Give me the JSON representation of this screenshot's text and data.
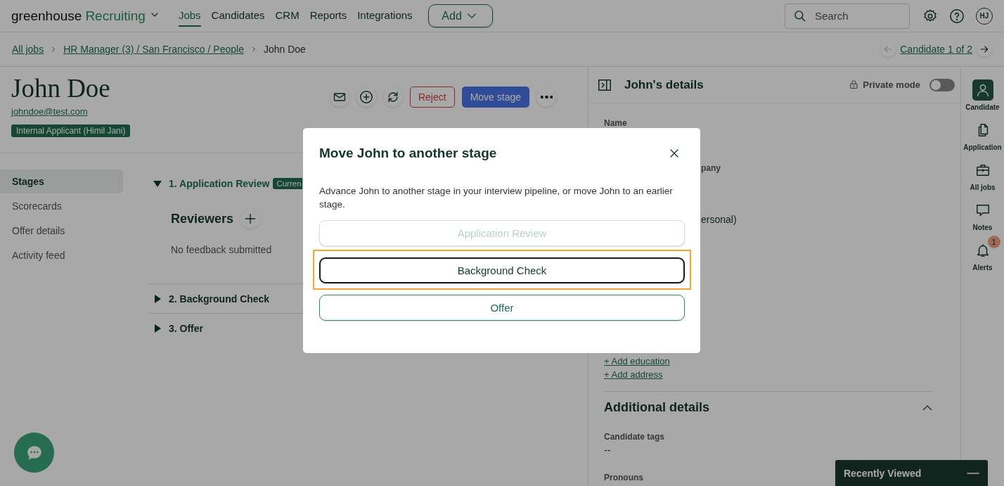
{
  "nav": {
    "logo": "greenhouse",
    "product": "Recruiting",
    "links": [
      {
        "label": "Jobs",
        "selected": true
      },
      {
        "label": "Candidates",
        "selected": false
      },
      {
        "label": "CRM",
        "selected": false
      },
      {
        "label": "Reports",
        "selected": false
      },
      {
        "label": "Integrations",
        "selected": false
      }
    ],
    "add_button": "Add",
    "search": {
      "placeholder": "Search"
    },
    "avatar": "HJ"
  },
  "breadcrumb": {
    "items": [
      "All jobs",
      "HR Manager (3) / San Francisco / People"
    ],
    "current": "John Doe",
    "pager": "Candidate 1 of 2",
    "prev_disabled": true
  },
  "candidate": {
    "name": "John Doe",
    "email": "johndoe@test.com",
    "tag": "Internal Applicant (Himil Jani)"
  },
  "actions": {
    "reject": "Reject",
    "move": "Move stage"
  },
  "sections": [
    {
      "label": "Stages",
      "selected": true
    },
    {
      "label": "Scorecards",
      "selected": false
    },
    {
      "label": "Offer details",
      "selected": false
    },
    {
      "label": "Activity feed",
      "selected": false
    }
  ],
  "stages": [
    {
      "label": "1. Application Review",
      "expanded": true,
      "badge": "Curren",
      "reviewers": "Reviewers",
      "feedback": "No feedback submitted"
    },
    {
      "label": "2. Background Check",
      "expanded": false
    },
    {
      "label": "3. Offer",
      "expanded": false
    }
  ],
  "details": {
    "title": "John's details",
    "private_mode": {
      "label": "Private mode",
      "on": false
    },
    "name_label": "Name",
    "fragment_label": "pany",
    "fragment_value": "ersonal)",
    "links": [
      "+ Add education",
      "+ Add address"
    ],
    "additional": {
      "title": "Additional details",
      "expanded": true,
      "fields": [
        {
          "label": "Candidate tags",
          "value": "--"
        },
        {
          "label": "Pronouns"
        }
      ]
    }
  },
  "rail": [
    {
      "label": "Candidate",
      "kind": "person",
      "selected": true
    },
    {
      "label": "Application",
      "kind": "documents",
      "selected": false
    },
    {
      "label": "All jobs",
      "kind": "briefcase",
      "selected": false
    },
    {
      "label": "Notes",
      "kind": "speech",
      "selected": false
    },
    {
      "label": "Alerts",
      "kind": "bell",
      "selected": false,
      "badge": "1"
    }
  ],
  "recently_viewed": {
    "title": "Recently Viewed"
  },
  "modal": {
    "title": "Move John to another stage",
    "description": "Advance John to another stage in your interview pipeline, or move John to an earlier stage.",
    "options": [
      {
        "label": "Application Review",
        "disabled": true,
        "selected": false
      },
      {
        "label": "Background Check",
        "disabled": false,
        "selected": true
      },
      {
        "label": "Offer",
        "disabled": false,
        "selected": false
      }
    ]
  }
}
